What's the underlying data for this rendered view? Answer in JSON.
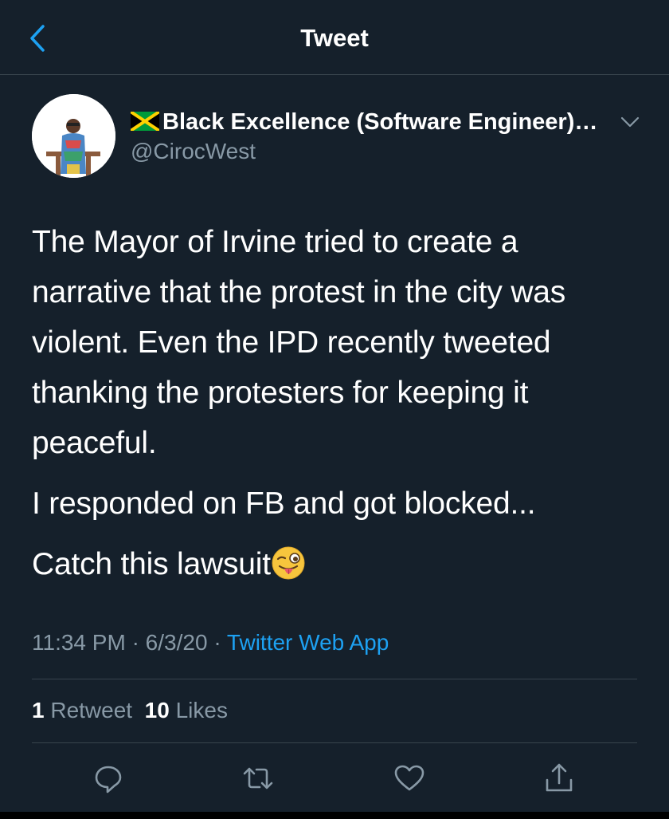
{
  "header": {
    "title": "Tweet",
    "back_icon": "chevron-left-icon"
  },
  "colors": {
    "background": "#15202b",
    "accent": "#1da1f2",
    "secondary_text": "#8899a6",
    "divider": "#38444d"
  },
  "author": {
    "display_name": "Black Excellence (Software Engineer)…",
    "flag_icon": "jamaica-flag-icon",
    "handle": "@CirocWest"
  },
  "tweet": {
    "paragraphs": [
      "The Mayor of Irvine tried to create a narrative that the protest in the city was violent. Even the IPD recently tweeted thanking the protesters for keeping it peaceful.",
      "I responded on FB and got blocked...",
      "Catch this lawsuit"
    ],
    "emoji_icon": "winking-face-with-tongue-icon"
  },
  "meta": {
    "time": "11:34 PM",
    "sep1": "·",
    "date": "6/3/20",
    "sep2": "·",
    "source": "Twitter Web App"
  },
  "stats": {
    "retweets_count": "1",
    "retweets_label": "Retweet",
    "likes_count": "10",
    "likes_label": "Likes"
  },
  "actions": [
    "reply-icon",
    "retweet-icon",
    "like-icon",
    "share-icon"
  ]
}
